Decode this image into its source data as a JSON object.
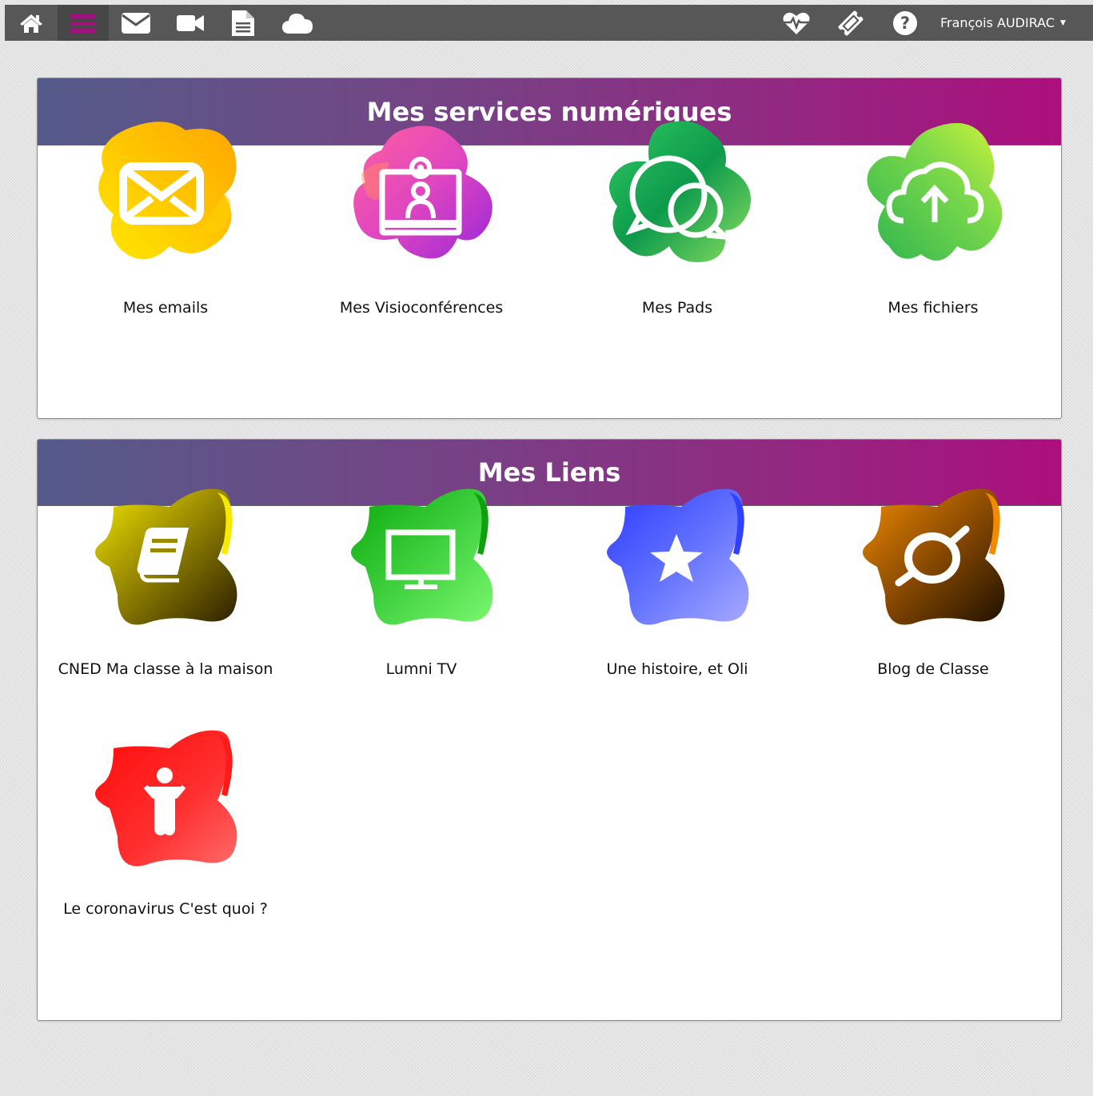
{
  "topbar": {
    "left_icons": [
      "home-icon",
      "menu-icon",
      "envelope-icon",
      "video-camera-icon",
      "document-icon",
      "cloud-icon"
    ],
    "active_icon": "menu-icon",
    "right_icons": [
      "heartbeat-icon",
      "ticket-icon",
      "help-icon"
    ],
    "user_name": "François AUDIRAC",
    "accent_color": "#a0127e"
  },
  "services": {
    "title": "Mes services numériques",
    "items": [
      {
        "label": "Mes emails",
        "icon": "envelope-icon",
        "colors": [
          "#ffb000",
          "#ffe000"
        ]
      },
      {
        "label": "Mes Visioconférences",
        "icon": "webcam-user-icon",
        "colors": [
          "#ff5fa0",
          "#b23ad0"
        ]
      },
      {
        "label": "Mes Pads",
        "icon": "chat-bubbles-icon",
        "colors": [
          "#10a850",
          "#7be060"
        ]
      },
      {
        "label": "Mes fichiers",
        "icon": "cloud-upload-icon",
        "colors": [
          "#3cbc50",
          "#c7f23a"
        ]
      }
    ]
  },
  "links": {
    "title": "Mes Liens",
    "items": [
      {
        "label": "CNED Ma classe à la maison",
        "icon": "book-icon",
        "colors": [
          "#f0e000",
          "#3a2a00"
        ]
      },
      {
        "label": "Lumni TV",
        "icon": "tv-icon",
        "colors": [
          "#10b010",
          "#70f060"
        ]
      },
      {
        "label": "Une histoire, et Oli",
        "icon": "star-icon",
        "colors": [
          "#3040ff",
          "#9aa0ff"
        ]
      },
      {
        "label": "Blog de Classe",
        "icon": "planet-ring-icon",
        "colors": [
          "#f08000",
          "#2a1500"
        ]
      },
      {
        "label": "Le coronavirus C'est quoi ?",
        "icon": "child-icon",
        "colors": [
          "#ff1010",
          "#ff6060"
        ]
      }
    ]
  }
}
